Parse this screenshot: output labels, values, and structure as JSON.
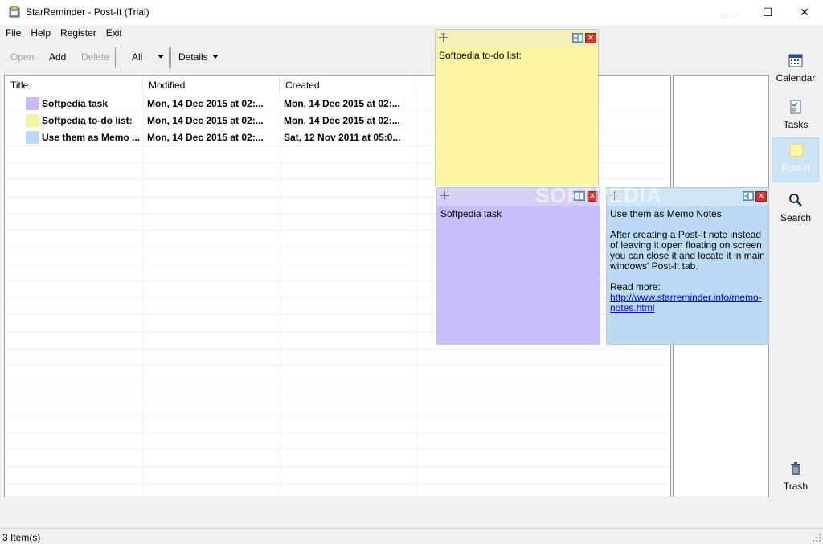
{
  "window": {
    "title": "StarReminder - Post-It  (Trial)",
    "minimize": "—",
    "maximize": "☐",
    "close": "✕"
  },
  "menu": [
    "File",
    "Help",
    "Register",
    "Exit"
  ],
  "toolbar": {
    "open": "Open",
    "add": "Add",
    "delete": "Delete",
    "filter": "All",
    "view": "Details"
  },
  "list": {
    "columns": [
      "Title",
      "Modified",
      "Created"
    ],
    "rows": [
      {
        "title": "Softpedia task",
        "modified": "Mon, 14 Dec 2015 at 02:...",
        "created": "Mon, 14 Dec 2015 at 02:...",
        "color": "#c8b8f8"
      },
      {
        "title": "Softpedia to-do list:",
        "modified": "Mon, 14 Dec 2015 at 02:...",
        "created": "Mon, 14 Dec 2015 at 02:...",
        "color": "#f9f0a0"
      },
      {
        "title": "Use them as Memo ...",
        "modified": "Mon, 14 Dec 2015 at 02:...",
        "created": "Sat, 12 Nov 2011 at 05:0...",
        "color": "#bcdaf4"
      }
    ]
  },
  "nav": {
    "calendar": "Calendar",
    "tasks": "Tasks",
    "postit": "Post-It",
    "search": "Search",
    "trash": "Trash"
  },
  "notes": {
    "todo": {
      "text": "Softpedia to-do list:",
      "color": "#faf6a3",
      "head_color": "#f4f0b8"
    },
    "task": {
      "text": "Softpedia task",
      "color": "#c8bdfa",
      "head_color": "#d7d0f4"
    },
    "memo": {
      "title": "Use them as Memo Notes",
      "para": "After creating a Post-It note instead of leaving it open floating on screen you can close it and locate it in main windows' Post-It tab.",
      "read_more": "Read more:",
      "link": "http://www.starreminder.info/memo-notes.html",
      "color": "#bcdaf4",
      "head_color": "#cfe6f7"
    }
  },
  "watermark": "SOFTPEDIA",
  "status": "3 Item(s)"
}
